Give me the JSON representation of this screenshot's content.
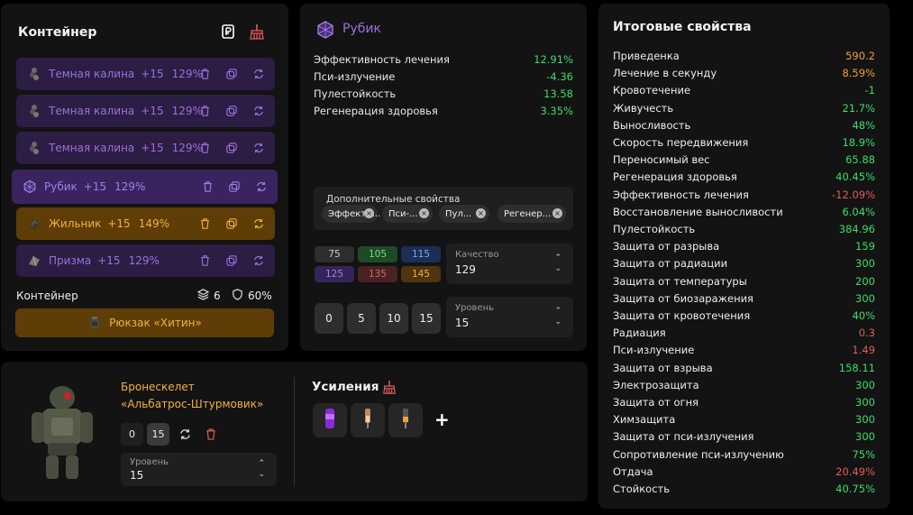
{
  "container": {
    "title": "Контейнер",
    "items": [
      {
        "name": "Темная калина",
        "plus": "+15",
        "pct": "129%",
        "style": "purple"
      },
      {
        "name": "Темная калина",
        "plus": "+15",
        "pct": "129%",
        "style": "purple"
      },
      {
        "name": "Темная калина",
        "plus": "+15",
        "pct": "129%",
        "style": "purple"
      },
      {
        "name": "Рубик",
        "plus": "+15",
        "pct": "129%",
        "style": "purple sel"
      },
      {
        "name": "Жильник",
        "plus": "+15",
        "pct": "149%",
        "style": "orange"
      },
      {
        "name": "Призма",
        "plus": "+15",
        "pct": "129%",
        "style": "purple"
      }
    ],
    "footer_label": "Контейнер",
    "slots": "6",
    "protection": "60%",
    "backpack": "Рюкзак «Хитин»"
  },
  "rubik": {
    "title": "Рубик",
    "props": [
      {
        "name": "Эффективность лечения",
        "value": "12.91%",
        "tone": "pos"
      },
      {
        "name": "Пси-излучение",
        "value": "-4.36",
        "tone": "pos"
      },
      {
        "name": "Пулестойкость",
        "value": "13.58",
        "tone": "pos"
      },
      {
        "name": "Регенерация здоровья",
        "value": "3.35%",
        "tone": "pos"
      }
    ],
    "extra_title": "Дополнительные свойства",
    "chips": [
      "Эффекти...",
      "Пси-...",
      "Пул...",
      "Регенер..."
    ],
    "quality_buttons": [
      {
        "label": "75",
        "color": "#2e2e2e",
        "text": "#cccccc"
      },
      {
        "label": "105",
        "color": "#1e4a27",
        "text": "#6ee08a"
      },
      {
        "label": "115",
        "color": "#1b2e55",
        "text": "#7ea8f0"
      },
      {
        "label": "125",
        "color": "#35245a",
        "text": "#a57ee6"
      },
      {
        "label": "135",
        "color": "#4a2222",
        "text": "#d06a6a"
      },
      {
        "label": "145",
        "color": "#4e3410",
        "text": "#f3b03e"
      }
    ],
    "quality_label": "Качество",
    "quality_value": "129",
    "level_buttons": [
      "0",
      "5",
      "10",
      "15"
    ],
    "level_label": "Уровень",
    "level_value": "15"
  },
  "armor": {
    "name_line1": "Бронескелет",
    "name_line2": "«Альбатрос-Штурмовик»",
    "btn_0": "0",
    "btn_15": "15",
    "level_label": "Уровень",
    "level_value": "15",
    "boost_title": "Усиления",
    "add": "+"
  },
  "totals": {
    "title": "Итоговые свойства",
    "rows": [
      {
        "name": "Приведенка",
        "value": "590.2",
        "tone": "o"
      },
      {
        "name": "Лечение в секунду",
        "value": "8.59%",
        "tone": "o"
      },
      {
        "name": "Кровотечение",
        "value": "-1",
        "tone": "g"
      },
      {
        "name": "Живучесть",
        "value": "21.7%",
        "tone": "g"
      },
      {
        "name": "Выносливость",
        "value": "48%",
        "tone": "g"
      },
      {
        "name": "Скорость передвижения",
        "value": "18.9%",
        "tone": "g"
      },
      {
        "name": "Переносимый вес",
        "value": "65.88",
        "tone": "g"
      },
      {
        "name": "Регенерация здоровья",
        "value": "40.45%",
        "tone": "g"
      },
      {
        "name": "Эффективность лечения",
        "value": "-12.09%",
        "tone": "r"
      },
      {
        "name": "Восстановление выносливости",
        "value": "6.04%",
        "tone": "g"
      },
      {
        "name": "Пулестойкость",
        "value": "384.96",
        "tone": "g"
      },
      {
        "name": "Защита от разрыва",
        "value": "159",
        "tone": "g"
      },
      {
        "name": "Защита от радиации",
        "value": "300",
        "tone": "g"
      },
      {
        "name": "Защита от температуры",
        "value": "200",
        "tone": "g"
      },
      {
        "name": "Защита от биозаражения",
        "value": "300",
        "tone": "g"
      },
      {
        "name": "Защита от кровотечения",
        "value": "40%",
        "tone": "g"
      },
      {
        "name": "Радиация",
        "value": "0.3",
        "tone": "r"
      },
      {
        "name": "Пси-излучение",
        "value": "1.49",
        "tone": "r"
      },
      {
        "name": "Защита от взрыва",
        "value": "158.11",
        "tone": "g"
      },
      {
        "name": "Электрозащита",
        "value": "300",
        "tone": "g"
      },
      {
        "name": "Защита от огня",
        "value": "300",
        "tone": "g"
      },
      {
        "name": "Химзащита",
        "value": "300",
        "tone": "g"
      },
      {
        "name": "Защита от пси-излучения",
        "value": "300",
        "tone": "g"
      },
      {
        "name": "Сопротивление пси-излучению",
        "value": "75%",
        "tone": "g"
      },
      {
        "name": "Отдача",
        "value": "20.49%",
        "tone": "r"
      },
      {
        "name": "Стойкость",
        "value": "40.75%",
        "tone": "g"
      }
    ]
  }
}
